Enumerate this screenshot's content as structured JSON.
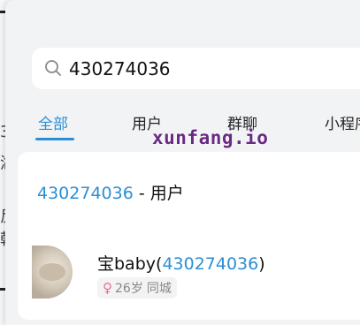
{
  "search": {
    "value": "430274036",
    "icon": "search-icon"
  },
  "tabs": [
    {
      "label": "全部",
      "active": true
    },
    {
      "label": "用户",
      "active": false
    },
    {
      "label": "群聊",
      "active": false
    },
    {
      "label": "小程序",
      "active": false
    }
  ],
  "results": {
    "section": {
      "query": "430274036",
      "separator": " - ",
      "type_label": "用户"
    },
    "user": {
      "name": "宝baby",
      "paren_open": "(",
      "id": "430274036",
      "paren_close": ")",
      "age": "26岁",
      "badge_extra": "同城"
    }
  },
  "watermark": "xunfang.io",
  "colors": {
    "accent": "#2a8fd6",
    "female": "#e86aa2",
    "watermark": "#6a2b84"
  }
}
